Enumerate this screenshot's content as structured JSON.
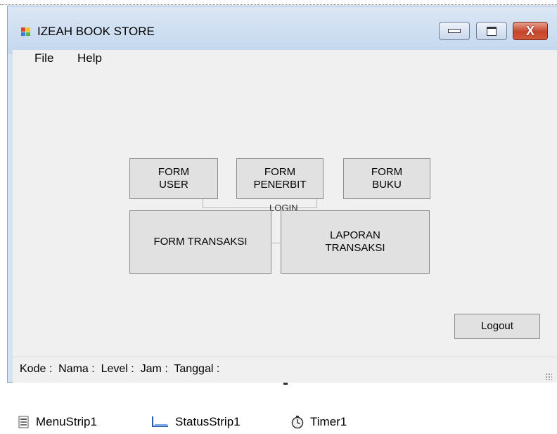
{
  "window": {
    "title": "IZEAH BOOK STORE",
    "controls": {
      "minimize": "minimize",
      "maximize": "maximize",
      "close": "X"
    }
  },
  "menu": {
    "file": "File",
    "help": "Help"
  },
  "buttons": {
    "form_user": "FORM\nUSER",
    "form_penerbit": "FORM\nPENERBIT",
    "form_buku": "FORM\nBUKU",
    "form_transaksi": "FORM TRANSAKSI",
    "laporan_transaksi": "LAPORAN\nTRANSAKSI",
    "logout": "Logout"
  },
  "hidden_label": "LOGIN",
  "status": {
    "text": "Kode :  Nama :  Level :  Jam :  Tanggal :"
  },
  "tray": {
    "menustrip": "MenuStrip1",
    "statusstrip": "StatusStrip1",
    "timer": "Timer1"
  },
  "colors": {
    "titlebar": "#c4d7ee",
    "client_bg": "#f0f0f0",
    "button_bg": "#e1e1e1",
    "close_button": "#c6432a"
  }
}
